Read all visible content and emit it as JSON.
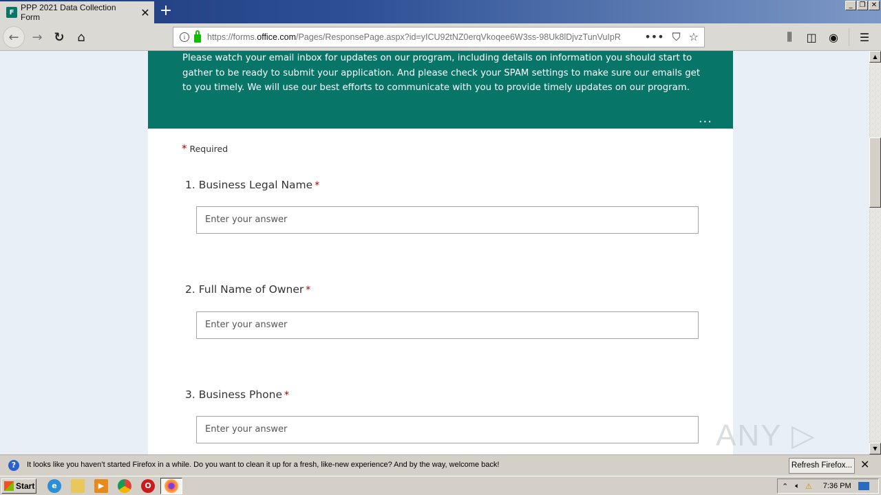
{
  "browser": {
    "tab_title": "PPP 2021 Data Collection Form",
    "tab_favicon": "F",
    "new_tab_label": "+",
    "url_prefix": "https://forms.",
    "url_domain": "office.com",
    "url_path": "/Pages/ResponsePage.aspx?id=yICU92tNZ0erqVkoqee6W3ss-98Uk8lDjvzTunVuIpR",
    "page_actions_icon": "•••",
    "window_controls": [
      "_",
      "❐",
      "✕"
    ]
  },
  "form": {
    "banner_text": "Please watch your email inbox for updates on our program, including details on information you should start to gather to be ready to submit your application. And please check your SPAM settings to make sure our emails get to you timely.  We will use our best efforts to communicate with you to provide timely updates on our program.",
    "banner_more": "...",
    "required_star": "*",
    "required_label": "Required",
    "questions": [
      {
        "label": "1. Business Legal Name",
        "required": "*",
        "placeholder": "Enter your answer"
      },
      {
        "label": "2. Full Name of Owner",
        "required": "*",
        "placeholder": "Enter your answer"
      },
      {
        "label": "3. Business Phone",
        "required": "*",
        "placeholder": "Enter your answer"
      }
    ],
    "accent_color": "#077568",
    "required_color": "#a80000"
  },
  "watermark": "ANY ▷ RUN",
  "notification": {
    "message": "It looks like you haven’t started Firefox in a while. Do you want to clean it up for a fresh, like-new experience? And by the way, welcome back!",
    "refresh_button": "Refresh Firefox...",
    "close": "✕"
  },
  "taskbar": {
    "start_label": "Start",
    "apps": [
      "internet-explorer",
      "file-explorer",
      "media-player",
      "chrome",
      "opera",
      "firefox"
    ],
    "clock": "7:36 PM"
  }
}
